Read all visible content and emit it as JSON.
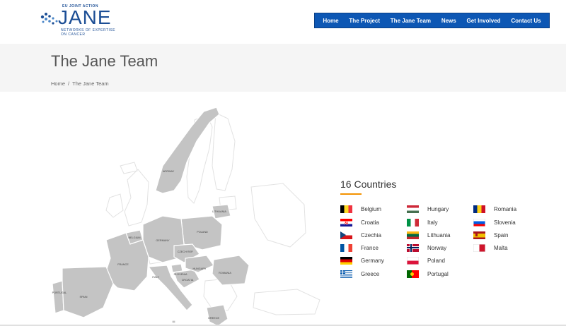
{
  "logo": {
    "top_text": "EU JOINT ACTION",
    "main_text": "JANE",
    "sub_line1": "NETWORKS OF EXPERTISE",
    "sub_line2": "ON CANCER"
  },
  "nav": {
    "items": [
      "Home",
      "The Project",
      "The Jane Team",
      "News",
      "Get Involved",
      "Contact Us"
    ]
  },
  "page": {
    "title": "The Jane Team",
    "breadcrumb": {
      "home": "Home",
      "separator": "/",
      "current": "The Jane Team"
    }
  },
  "map": {
    "labels": [
      "NORWAY",
      "LITHUANIA",
      "BELGIUM",
      "POLAND",
      "GERMANY",
      "CZECH REP.",
      "FRANCE",
      "SLOVENIA",
      "HUNGARY",
      "ROMANIA",
      "CROATIA",
      "ITALY",
      "PORTUGAL",
      "SPAIN",
      "GREECE"
    ],
    "highlight_color": "#c4c4c4",
    "outline_color": "#e4e4e4"
  },
  "countries": {
    "title": "16 Countries",
    "accent_color": "#f39200",
    "columns": [
      [
        {
          "name": "Belgium",
          "flag": "belgium"
        },
        {
          "name": "Croatia",
          "flag": "croatia"
        },
        {
          "name": "Czechia",
          "flag": "czechia"
        },
        {
          "name": "France",
          "flag": "france"
        },
        {
          "name": "Germany",
          "flag": "germany"
        },
        {
          "name": "Greece",
          "flag": "greece"
        }
      ],
      [
        {
          "name": "Hungary",
          "flag": "hungary"
        },
        {
          "name": "Italy",
          "flag": "italy"
        },
        {
          "name": "Lithuania",
          "flag": "lithuania"
        },
        {
          "name": "Norway",
          "flag": "norway"
        },
        {
          "name": "Poland",
          "flag": "poland"
        },
        {
          "name": "Portugal",
          "flag": "portugal"
        }
      ],
      [
        {
          "name": "Romania",
          "flag": "romania"
        },
        {
          "name": "Slovenia",
          "flag": "slovenia"
        },
        {
          "name": "Spain",
          "flag": "spain"
        },
        {
          "name": "Malta",
          "flag": "malta"
        }
      ]
    ]
  }
}
